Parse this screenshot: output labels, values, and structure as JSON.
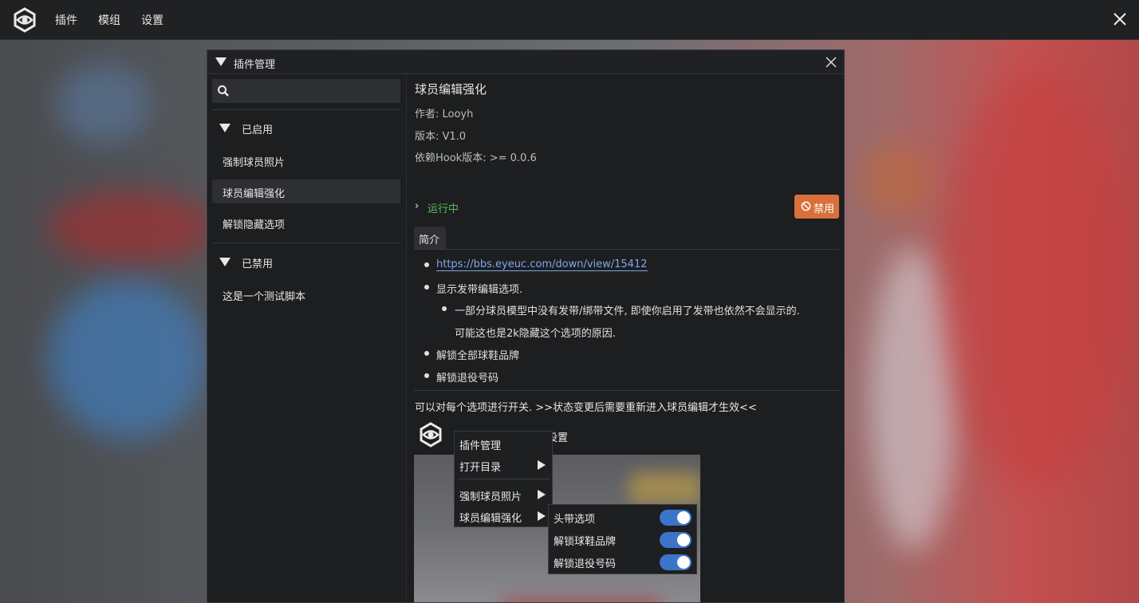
{
  "topbar": {
    "menu": [
      "插件",
      "模组",
      "设置"
    ]
  },
  "plugin_manager": {
    "title": "插件管理",
    "search": {
      "placeholder": "",
      "value": ""
    },
    "enabled_group": {
      "label": "已启用",
      "items": [
        "强制球员照片",
        "球员编辑强化",
        "解锁隐藏选项"
      ],
      "selected_index": 1
    },
    "disabled_group": {
      "label": "已禁用",
      "items": [
        "这是一个测试脚本"
      ]
    }
  },
  "detail": {
    "title": "球员编辑强化",
    "author": "作者: Looyh",
    "version": "版本: V1.0",
    "hook_version": "依赖Hook版本: >= 0.0.6",
    "status": "运行中",
    "disable_button": "禁用",
    "tab": "简介",
    "bullets": {
      "link": "https://bbs.eyeuc.com/down/view/15412",
      "b2": "显示发带编辑选项.",
      "b2_sub1": "一部分球员模型中没有发带/绑带文件, 即使你启用了发带也依然不会显示的.",
      "b2_sub2": "可能这也是2k隐藏这个选项的原因.",
      "b3": "解锁全部球鞋品牌",
      "b4": "解锁退役号码"
    },
    "note": "可以对每个选项进行开关. >>状态变更后需要重新进入球员编辑才生效<<"
  },
  "preview": {
    "menu": [
      "插件",
      "模组",
      "设置"
    ],
    "ctx_menu": [
      "插件管理",
      "打开目录",
      "强制球员照片",
      "球员编辑强化"
    ],
    "submenu": [
      {
        "label": "头带选项",
        "on": true
      },
      {
        "label": "解锁球鞋品牌",
        "on": true
      },
      {
        "label": "解锁退役号码",
        "on": true
      }
    ]
  },
  "colors": {
    "accent_blue": "#3b74c9",
    "disable_orange": "#d9703c",
    "status_green": "#5cb85c",
    "link": "#7ea7ea"
  }
}
